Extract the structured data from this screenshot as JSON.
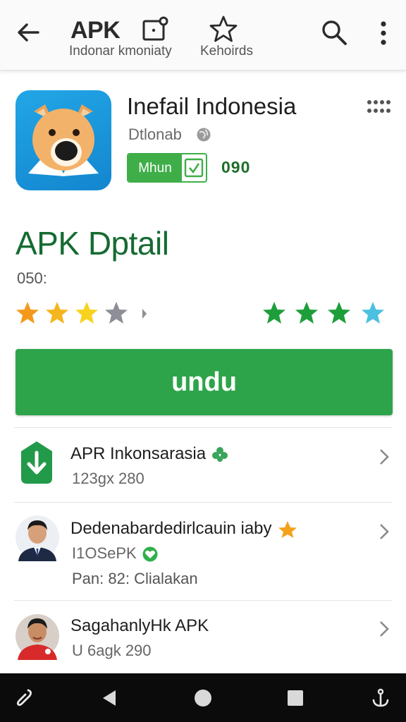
{
  "topbar": {
    "title": "APK",
    "subtitle_left": "Indonar kmoniaty",
    "subtitle_right": "Kehoirds",
    "icons": [
      "back-arrow-icon",
      "camera-icon",
      "star-outline-icon",
      "search-icon",
      "more-vert-icon"
    ]
  },
  "app": {
    "name": "Inefail Indonesia",
    "developer": "Dtlonab",
    "badge_label": "Mhun",
    "count": "090",
    "colors": {
      "icon_bg": "#1a97dd",
      "badge_green": "#3fae49"
    }
  },
  "section": {
    "title": "APK Dptail",
    "count": "050:",
    "rating_left": {
      "filled": 3,
      "empty": 1
    },
    "rating_right_colors": [
      "#1e9e3a",
      "#1e9e3a",
      "#1e9e3a",
      "#4cc0e0"
    ]
  },
  "download_button": {
    "label": "undu"
  },
  "list": [
    {
      "title": "APR Inkonsarasia",
      "sub": "123gx 280",
      "extra": ""
    },
    {
      "title": "Dedenabardedirlcauin iaby",
      "sub": "I1OSePK",
      "extra": "Pan: 82: Clialakan"
    },
    {
      "title": "SagahanlyHk APK",
      "sub": "U 6agk 290",
      "extra": ""
    }
  ],
  "navbar": {
    "icons": [
      "mic-icon",
      "back-triangle-icon",
      "home-circle-icon",
      "recents-square-icon",
      "anchor-icon"
    ]
  },
  "accent": "#2ea44a"
}
